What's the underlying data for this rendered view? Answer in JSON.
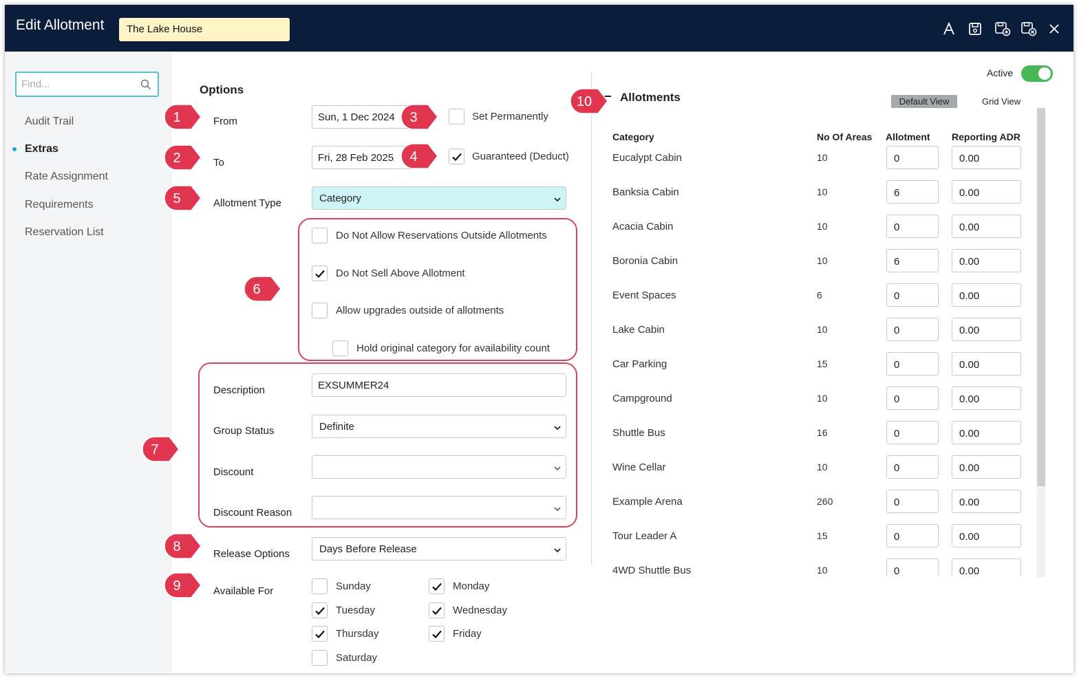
{
  "window": {
    "title": "Edit Allotment",
    "property": "The Lake House"
  },
  "toolbar": {
    "icons": [
      "font-icon",
      "save-icon",
      "save-add-icon",
      "save-close-icon",
      "close-icon"
    ]
  },
  "sidebar": {
    "search_placeholder": "Find...",
    "items": [
      {
        "label": "Audit Trail",
        "active": false
      },
      {
        "label": "Extras",
        "active": true
      },
      {
        "label": "Rate Assignment",
        "active": false
      },
      {
        "label": "Requirements",
        "active": false
      },
      {
        "label": "Reservation List",
        "active": false
      }
    ]
  },
  "options": {
    "heading": "Options",
    "from_label": "From",
    "from_value": "Sun, 1 Dec 2024",
    "to_label": "To",
    "to_value": "Fri, 28 Feb 2025",
    "set_permanently": {
      "label": "Set Permanently",
      "checked": false
    },
    "guaranteed": {
      "label": "Guaranteed (Deduct)",
      "checked": true
    },
    "allotment_type_label": "Allotment Type",
    "allotment_type_value": "Category",
    "rules": [
      {
        "label": "Do Not Allow Reservations Outside Allotments",
        "checked": false
      },
      {
        "label": "Do Not Sell Above Allotment",
        "checked": true
      },
      {
        "label": "Allow upgrades outside of allotments",
        "checked": false
      },
      {
        "label": "Hold original category for availability count",
        "checked": false
      }
    ],
    "description_label": "Description",
    "description_value": "EXSUMMER24",
    "group_status_label": "Group Status",
    "group_status_value": "Definite",
    "discount_label": "Discount",
    "discount_value": "",
    "discount_reason_label": "Discount Reason",
    "discount_reason_value": "",
    "release_options_label": "Release Options",
    "release_options_value": "Days Before Release",
    "available_for_label": "Available For",
    "days": {
      "sunday": {
        "label": "Sunday",
        "checked": false
      },
      "monday": {
        "label": "Monday",
        "checked": true
      },
      "tuesday": {
        "label": "Tuesday",
        "checked": true
      },
      "wednesday": {
        "label": "Wednesday",
        "checked": true
      },
      "thursday": {
        "label": "Thursday",
        "checked": true
      },
      "friday": {
        "label": "Friday",
        "checked": true
      },
      "saturday": {
        "label": "Saturday",
        "checked": false
      }
    }
  },
  "annotations": [
    "1",
    "2",
    "3",
    "4",
    "5",
    "6",
    "7",
    "8",
    "9",
    "10"
  ],
  "allotments": {
    "heading": "Allotments",
    "active_label": "Active",
    "active_on": true,
    "default_view": "Default View",
    "grid_view": "Grid View",
    "columns": [
      "Category",
      "No Of Areas",
      "Allotment",
      "Reporting ADR"
    ],
    "rows": [
      {
        "category": "Eucalypt Cabin",
        "areas": "10",
        "allotment": "0",
        "adr": "0.00"
      },
      {
        "category": "Banksia Cabin",
        "areas": "10",
        "allotment": "6",
        "adr": "0.00"
      },
      {
        "category": "Acacia Cabin",
        "areas": "10",
        "allotment": "0",
        "adr": "0.00"
      },
      {
        "category": "Boronia Cabin",
        "areas": "10",
        "allotment": "6",
        "adr": "0.00"
      },
      {
        "category": "Event Spaces",
        "areas": "6",
        "allotment": "0",
        "adr": "0.00"
      },
      {
        "category": "Lake Cabin",
        "areas": "10",
        "allotment": "0",
        "adr": "0.00"
      },
      {
        "category": "Car Parking",
        "areas": "15",
        "allotment": "0",
        "adr": "0.00"
      },
      {
        "category": "Campground",
        "areas": "10",
        "allotment": "0",
        "adr": "0.00"
      },
      {
        "category": "Shuttle Bus",
        "areas": "16",
        "allotment": "0",
        "adr": "0.00"
      },
      {
        "category": "Wine Cellar",
        "areas": "10",
        "allotment": "0",
        "adr": "0.00"
      },
      {
        "category": "Example Arena",
        "areas": "260",
        "allotment": "0",
        "adr": "0.00"
      },
      {
        "category": "Tour Leader A",
        "areas": "15",
        "allotment": "0",
        "adr": "0.00"
      },
      {
        "category": "4WD Shuttle Bus",
        "areas": "10",
        "allotment": "0",
        "adr": "0.00"
      }
    ]
  },
  "colors": {
    "titlebar": "#0a1e3b",
    "accent": "#56c2cf",
    "badge": "#e03650",
    "toggle_on": "#48b758",
    "select_highlight": "#cff4f8"
  }
}
